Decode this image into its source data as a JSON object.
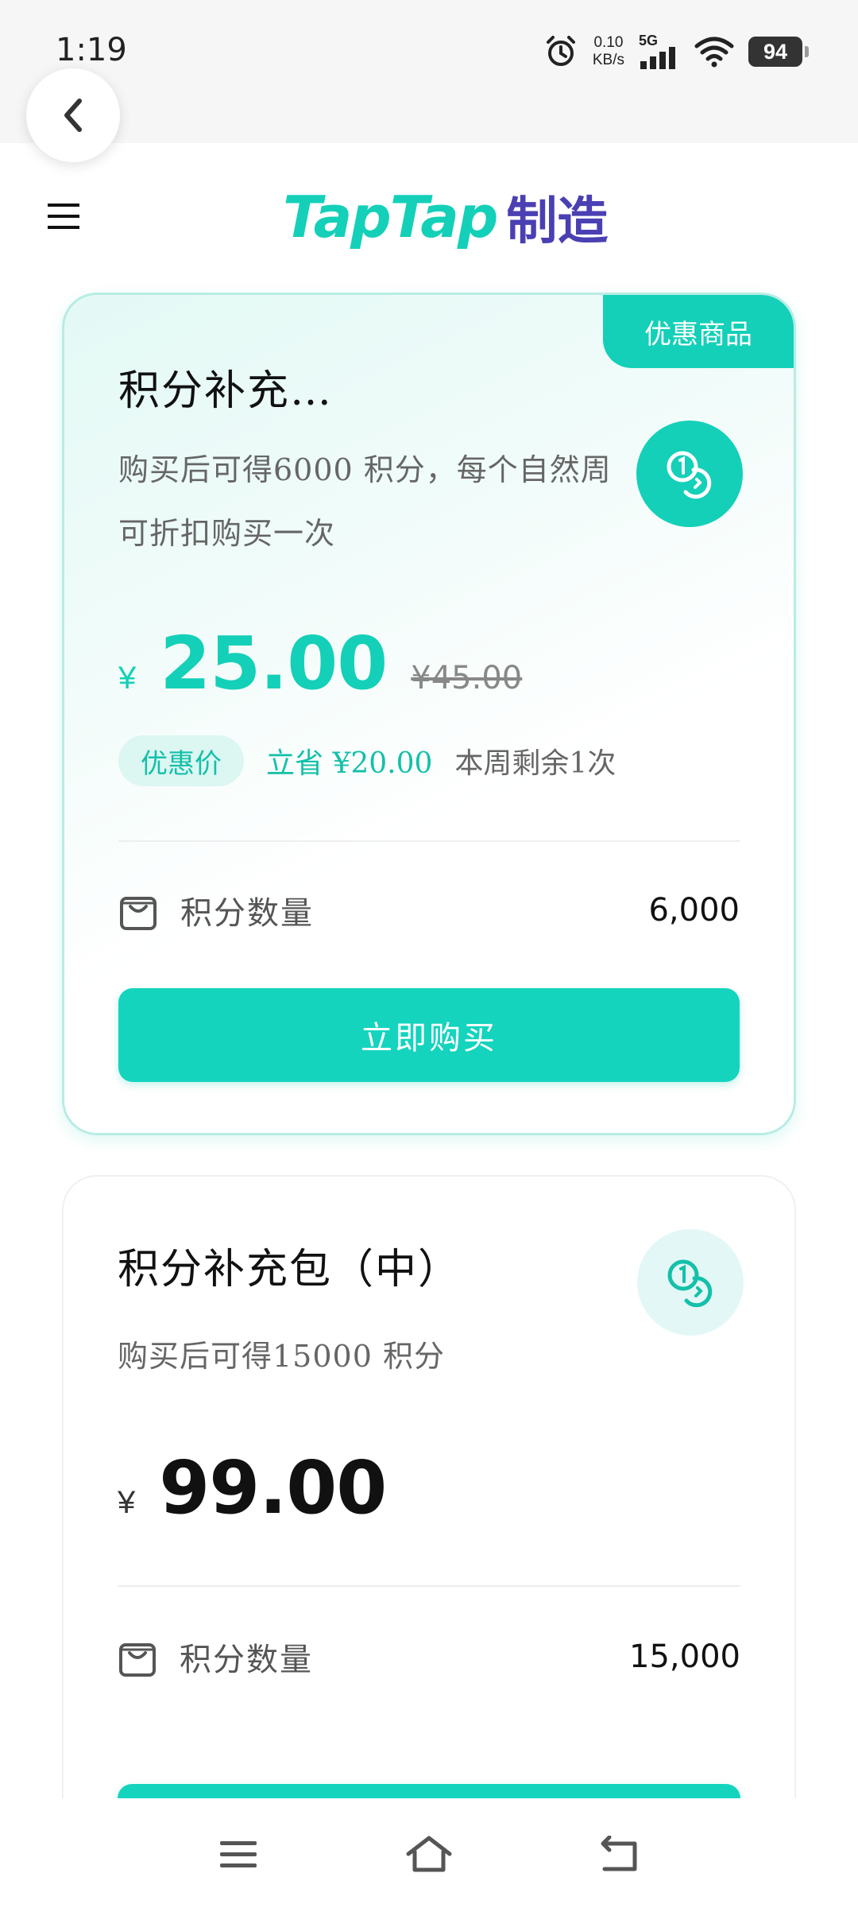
{
  "status_bar": {
    "time": "1:19",
    "net_speed_value": "0.10",
    "net_speed_unit": "KB/s",
    "network": "5G",
    "battery": "94"
  },
  "header": {
    "logo_en": "TapTap",
    "logo_cn": "制造"
  },
  "products": [
    {
      "tag": "优惠商品",
      "title": "积分补充…",
      "description": "购买后可得6000 积分，每个自然周可折扣购买一次",
      "currency": "¥",
      "price": "25.00",
      "original_price": "¥45.00",
      "discount_label": "优惠价",
      "savings": "立省 ¥20.00",
      "remaining": "本周剩余1次",
      "qty_label": "积分数量",
      "qty_value": "6,000",
      "buy_label": "立即购买"
    },
    {
      "title": "积分补充包（中）",
      "description": "购买后可得15000 积分",
      "currency": "¥",
      "price": "99.00",
      "qty_label": "积分数量",
      "qty_value": "15,000"
    }
  ],
  "colors": {
    "accent": "#14d0b8",
    "logo_purple": "#4a3fb3"
  }
}
